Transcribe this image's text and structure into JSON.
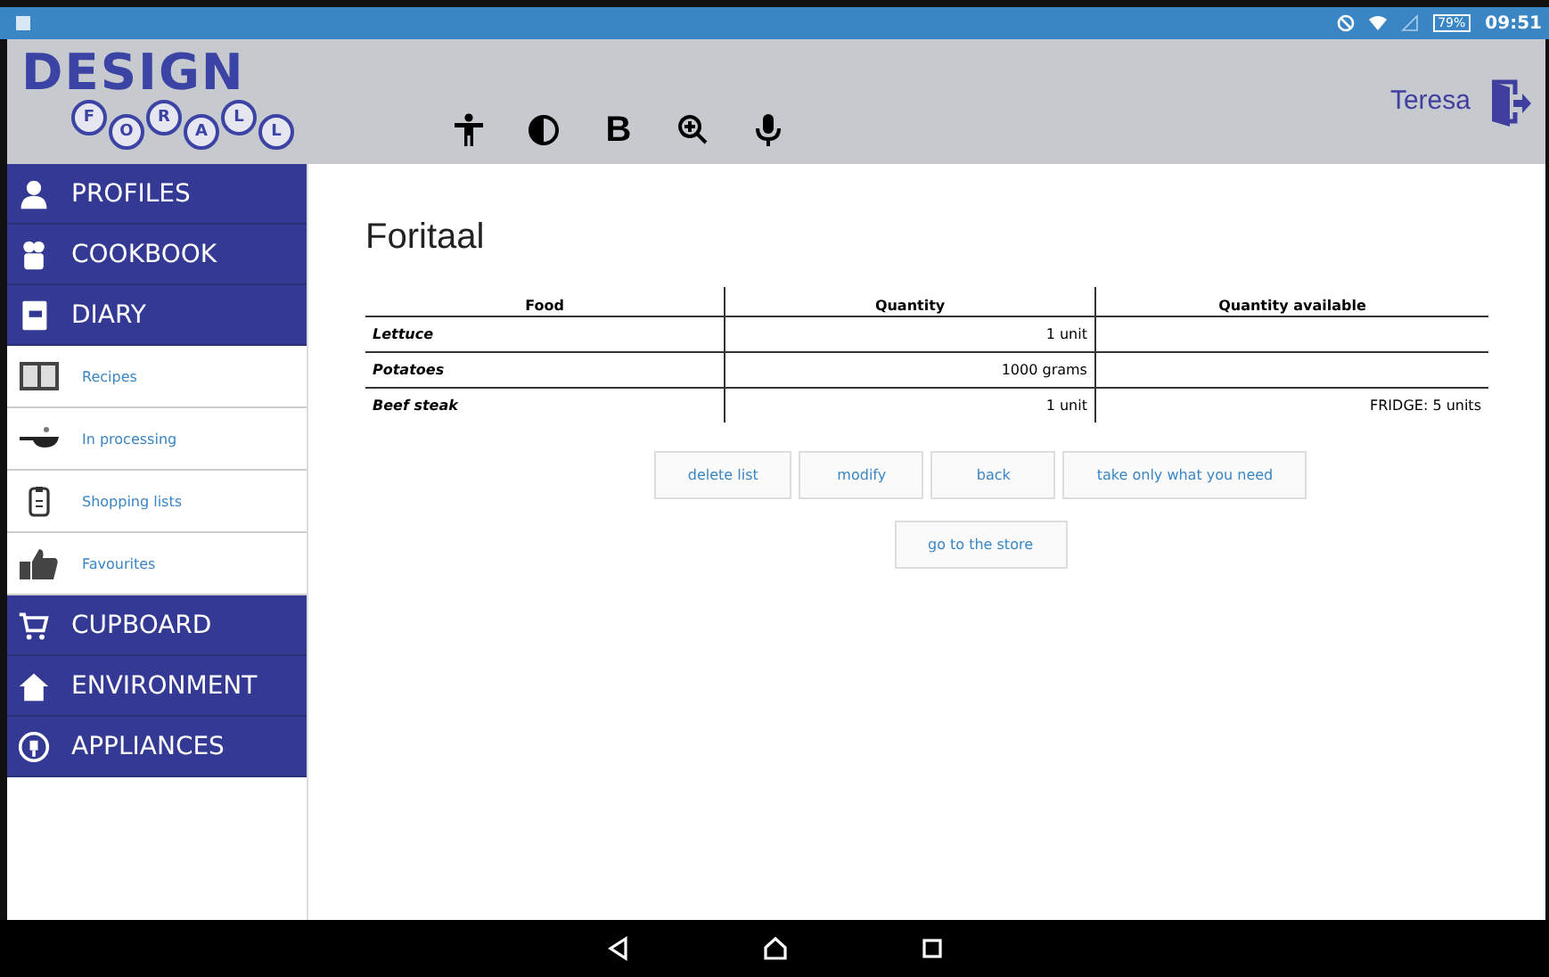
{
  "status_bar": {
    "battery": "79%",
    "time": "09:51"
  },
  "header": {
    "logo": {
      "title": "DESIGN",
      "letters": [
        "F",
        "O",
        "R",
        "A",
        "L",
        "L"
      ]
    },
    "toolbar": [
      {
        "kind": "accessibility"
      },
      {
        "kind": "contrast"
      },
      {
        "kind": "bold",
        "label": "B"
      },
      {
        "kind": "zoom"
      },
      {
        "kind": "mic"
      }
    ],
    "user": "Teresa"
  },
  "sidebar": {
    "items": [
      {
        "label": "PROFILES",
        "kind": "person"
      },
      {
        "label": "COOKBOOK",
        "kind": "chef"
      },
      {
        "label": "DIARY",
        "kind": "notebook",
        "expanded": true,
        "children": [
          {
            "label": "Recipes",
            "kind": "book"
          },
          {
            "label": "In processing",
            "kind": "pan"
          },
          {
            "label": "Shopping lists",
            "kind": "clipboard"
          },
          {
            "label": "Favourites",
            "kind": "thumb"
          }
        ]
      },
      {
        "label": "CUPBOARD",
        "kind": "cart"
      },
      {
        "label": "ENVIRONMENT",
        "kind": "home"
      },
      {
        "label": "APPLIANCES",
        "kind": "plug"
      }
    ]
  },
  "page": {
    "title": "Foritaal",
    "table": {
      "columns": [
        "Food",
        "Quantity",
        "Quantity available"
      ],
      "rows": [
        [
          "Lettuce",
          "1 unit",
          ""
        ],
        [
          "Potatoes",
          "1000 grams",
          ""
        ],
        [
          "Beef steak",
          "1 unit",
          "FRIDGE: 5 units"
        ]
      ]
    },
    "buttons": [
      [
        "delete list",
        "modify",
        "back",
        "take only what you need"
      ],
      [
        "go to the store"
      ]
    ]
  },
  "nav_bar": [
    {
      "kind": "back"
    },
    {
      "kind": "home"
    },
    {
      "kind": "recents"
    }
  ]
}
